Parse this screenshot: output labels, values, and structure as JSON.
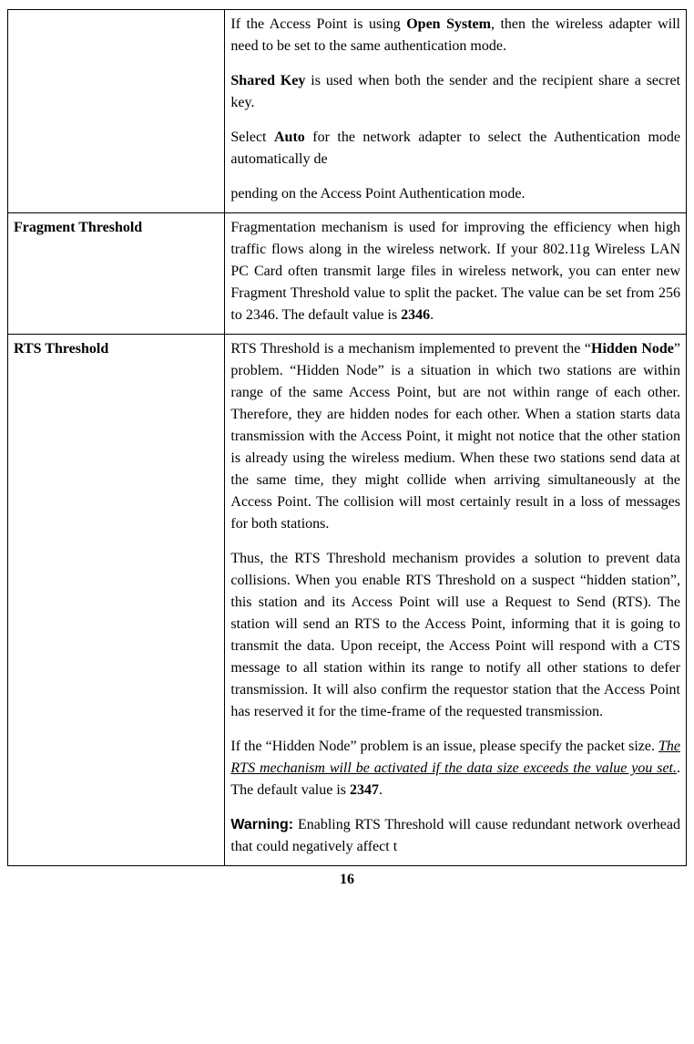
{
  "page_number": "16",
  "rows": [
    {
      "label": "",
      "pieces": [
        {
          "type": "para",
          "runs": [
            {
              "t": "If the Access Point is using "
            },
            {
              "t": "Open System",
              "cls": "bold"
            },
            {
              "t": ", then the wireless adapter will need to be set to the same authentication mode."
            }
          ]
        },
        {
          "type": "para",
          "runs": [
            {
              "t": "Shared Key",
              "cls": "bold"
            },
            {
              "t": " is used when both the sender and the recipient share a secret key."
            }
          ]
        },
        {
          "type": "para",
          "runs": [
            {
              "t": "Select "
            },
            {
              "t": "Auto",
              "cls": "bold"
            },
            {
              "t": " for the network adapter to select the Authentication mode automatically de"
            }
          ]
        },
        {
          "type": "para",
          "last": true,
          "runs": [
            {
              "t": "pending on the Access Point Authentication mode."
            }
          ]
        }
      ]
    },
    {
      "label": "Fragment Threshold",
      "pieces": [
        {
          "type": "para",
          "last": true,
          "runs": [
            {
              "t": "Fragmentation mechanism is used for improving the efficiency when high traffic flows along in the wireless network. If your 802.11g Wireless LAN PC Card often transmit large files in wireless network, you can enter new Fragment Threshold value to split the packet.  The value can be set from 256 to 2346. The default value is "
            },
            {
              "t": "2346",
              "cls": "bold"
            },
            {
              "t": "."
            }
          ]
        }
      ]
    },
    {
      "label": "RTS Threshold",
      "pieces": [
        {
          "type": "para",
          "runs": [
            {
              "t": "RTS Threshold is a mechanism implemented to prevent the “"
            },
            {
              "t": "Hidden Node",
              "cls": "bold"
            },
            {
              "t": "” problem. “Hidden Node” is a situation in which two stations are within range of the same Access Point, but are not within range of each other. Therefore, they are hidden nodes for each other. When a station starts data transmission with the Access Point, it might not notice that the other station is already using the wireless medium. When these two stations send data at the same time, they might collide when arriving simultaneously at the Access Point. The collision will most certainly result in a loss of messages for both stations."
            }
          ]
        },
        {
          "type": "para",
          "runs": [
            {
              "t": "Thus, the RTS Threshold mechanism provides a solution to prevent data collisions. When you enable RTS Threshold on a suspect “hidden station”, this station and its Access Point will use a Request to Send (RTS). The station will send an RTS to the Access Point, informing that it is going to transmit the data. Upon receipt, the Access Point will respond with a CTS message to all station within its range to notify all other stations to defer transmission. It will also confirm the requestor station that the Access Point has reserved it for the time-frame of the requested transmission."
            }
          ]
        },
        {
          "type": "para",
          "runs": [
            {
              "t": "If the “Hidden Node” problem is an issue, please specify the packet size. "
            },
            {
              "t": "The RTS mechanism will be activated if the data size exceeds the value you set.",
              "cls": "underline-italic"
            },
            {
              "t": ". The default value is "
            },
            {
              "t": "2347",
              "cls": "bold"
            },
            {
              "t": "."
            }
          ]
        },
        {
          "type": "para",
          "last": true,
          "runs": [
            {
              "t": "Warning:",
              "cls": "warn"
            },
            {
              "t": " Enabling RTS Threshold will cause redundant network overhead that could negatively affect t"
            }
          ]
        }
      ]
    }
  ]
}
